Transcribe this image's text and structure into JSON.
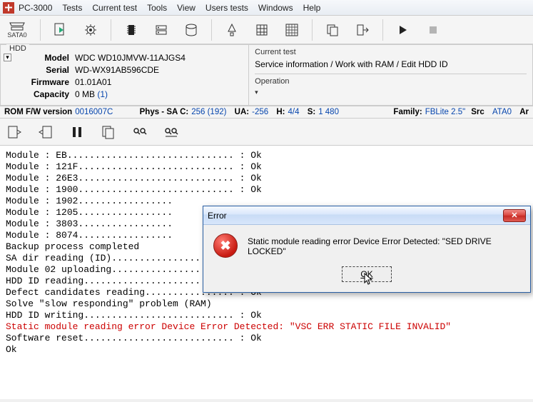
{
  "app_title": "PC-3000",
  "menu": [
    "Tests",
    "Current test",
    "Tools",
    "View",
    "Users tests",
    "Windows",
    "Help"
  ],
  "sata_label": "SATA0",
  "hdd_panel": {
    "title": "HDD",
    "rows": [
      {
        "label": "Model",
        "value": "WDC WD10JMVW-11AJGS4"
      },
      {
        "label": "Serial",
        "value": "WD-WX91AB596CDE"
      },
      {
        "label": "Firmware",
        "value": "01.01A01"
      },
      {
        "label": "Capacity",
        "value": "0 MB ",
        "link": "(1)"
      }
    ]
  },
  "current_test": {
    "title": "Current test",
    "path": "Service information / Work with RAM / Edit HDD ID",
    "operation_title": "Operation",
    "operation_marker": "▾"
  },
  "status": {
    "rom_label": "ROM F/W version",
    "rom_value": "0016007C",
    "phys_label": "Phys - SA C:",
    "phys_c": "256 (192)",
    "ua_label": "UA:",
    "ua_value": "-256",
    "h_label": "H:",
    "h_value": "4/4",
    "s_label": "S:",
    "s_value": "1 480",
    "family_label": "Family:",
    "family_value": "FBLite 2.5\"",
    "src_label": "Src",
    "src_value": "ATA0",
    "src_suffix": "Ar"
  },
  "log_lines": [
    {
      "t": "Module : EB.............................. : Ok"
    },
    {
      "t": "Module : 121F............................ : Ok"
    },
    {
      "t": "Module : 26E3............................ : Ok"
    },
    {
      "t": "Module : 1900............................ : Ok"
    },
    {
      "t": "Module : 1902................."
    },
    {
      "t": "Module : 1205................."
    },
    {
      "t": "Module : 3803................."
    },
    {
      "t": "Module : 8074................."
    },
    {
      "t": "Backup process completed"
    },
    {
      "t": ""
    },
    {
      "t": "SA dir reading (ID)...................... : "
    },
    {
      "t": "Module 02 uploading...................... : Ok"
    },
    {
      "t": ""
    },
    {
      "t": "HDD ID reading........................... : Ok"
    },
    {
      "t": "Defect candidates reading................ : Ok"
    },
    {
      "t": "Solve \"slow responding\" problem (RAM)"
    },
    {
      "t": "HDD ID writing........................... : Ok"
    },
    {
      "t": "Static module reading error Device Error Detected: \"VSC ERR STATIC FILE INVALID\"",
      "cls": "red"
    },
    {
      "t": "Software reset........................... : Ok"
    },
    {
      "t": "Ok"
    }
  ],
  "dialog": {
    "title": "Error",
    "message": "Static module reading error Device Error Detected: \"SED DRIVE LOCKED\"",
    "ok": "OK",
    "close_glyph": "✕"
  }
}
